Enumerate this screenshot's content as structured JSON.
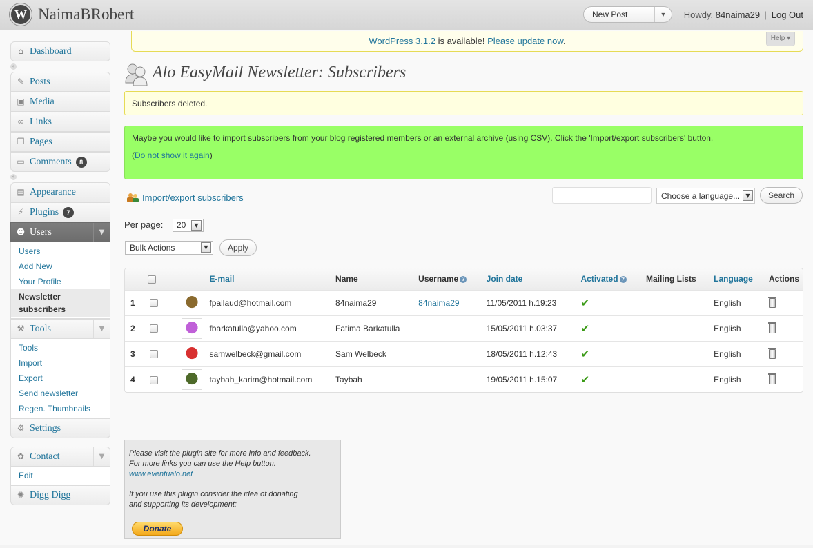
{
  "header": {
    "logo_letter": "W",
    "site_title": "NaimaBRobert",
    "new_post_label": "New Post",
    "howdy_prefix": "Howdy,",
    "username": "84naima29",
    "separator": "|",
    "logout_label": "Log Out"
  },
  "update_nag": {
    "version_link": "WordPress 3.1.2",
    "middle_text": " is available! ",
    "update_link": "Please update now",
    "end_text": ".",
    "help_label": "Help"
  },
  "sidebar": {
    "dashboard": "Dashboard",
    "posts": "Posts",
    "media": "Media",
    "links": "Links",
    "pages": "Pages",
    "comments": "Comments",
    "comments_count": "8",
    "appearance": "Appearance",
    "plugins": "Plugins",
    "plugins_count": "7",
    "users": "Users",
    "users_sub": [
      "Users",
      "Add New",
      "Your Profile",
      "Newsletter subscribers"
    ],
    "tools": "Tools",
    "tools_sub": [
      "Tools",
      "Import",
      "Export",
      "Send newsletter",
      "Regen. Thumbnails"
    ],
    "settings": "Settings",
    "contact": "Contact",
    "contact_sub": [
      "Edit"
    ],
    "digg": "Digg Digg"
  },
  "page": {
    "title": "Alo EasyMail Newsletter: Subscribers",
    "msg_updated": "Subscribers deleted.",
    "msg_import": "Maybe you would like to import subscribers from your blog registered members or an external archive (using CSV). Click the 'Import/export subscribers' button.",
    "dismiss_open": "(",
    "dismiss_link": "Do not show it again",
    "dismiss_close": ")",
    "import_link": "Import/export subscribers",
    "language_placeholder": "Choose a language...",
    "search_label": "Search",
    "perpage_label": "Per page:",
    "perpage_value": "20",
    "bulk_label": "Bulk Actions",
    "apply_label": "Apply"
  },
  "table": {
    "headers": {
      "email": "E-mail",
      "name": "Name",
      "username": "Username",
      "join_date": "Join date",
      "activated": "Activated",
      "mailing_lists": "Mailing Lists",
      "language": "Language",
      "actions": "Actions"
    },
    "rows": [
      {
        "num": "1",
        "email": "fpallaud@hotmail.com",
        "name": "84naima29",
        "username": "84naima29",
        "join_date": "11/05/2011 h.19:23",
        "activated": "✔",
        "mailing_lists": "",
        "language": "English",
        "avatar_color": "#8a6a2e"
      },
      {
        "num": "2",
        "email": "fbarkatulla@yahoo.com",
        "name": "Fatima Barkatulla",
        "username": "",
        "join_date": "15/05/2011 h.03:37",
        "activated": "✔",
        "mailing_lists": "",
        "language": "English",
        "avatar_color": "#c060d8"
      },
      {
        "num": "3",
        "email": "samwelbeck@gmail.com",
        "name": "Sam Welbeck",
        "username": "",
        "join_date": "18/05/2011 h.12:43",
        "activated": "✔",
        "mailing_lists": "",
        "language": "English",
        "avatar_color": "#d83030"
      },
      {
        "num": "4",
        "email": "taybah_karim@hotmail.com",
        "name": "Taybah",
        "username": "",
        "join_date": "19/05/2011 h.15:07",
        "activated": "✔",
        "mailing_lists": "",
        "language": "English",
        "avatar_color": "#4e6a2a"
      }
    ]
  },
  "info_box": {
    "line1": "Please visit the plugin site for more info and feedback.",
    "line2": "For more links you can use the Help button.",
    "link": "www.eventualo.net",
    "line3": "If you use this plugin consider the idea of donating",
    "line4": "and supporting its development:",
    "donate_label": "Donate"
  },
  "colors": {
    "accent": "#21759b",
    "import_bg": "#99ff66",
    "notice_bg": "#ffffe0",
    "menu_open": "#6d6d6d"
  }
}
